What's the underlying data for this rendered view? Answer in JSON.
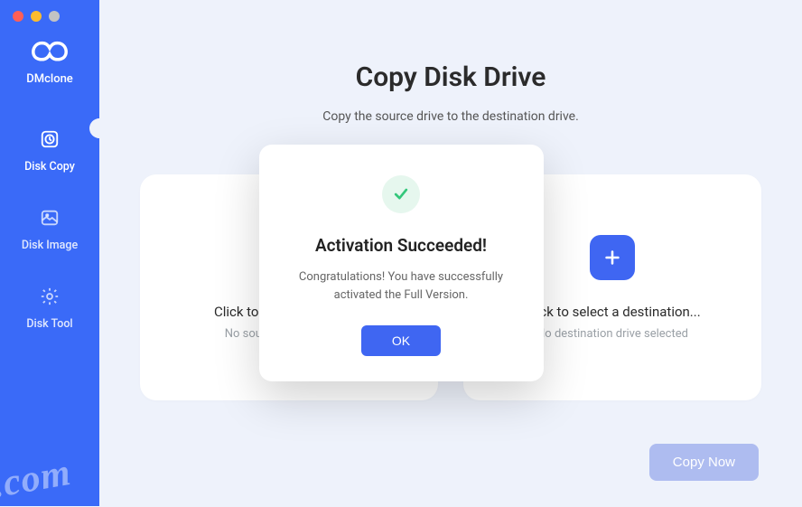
{
  "brand": {
    "name": "DMclone"
  },
  "sidebar": {
    "items": [
      {
        "label": "Disk Copy",
        "icon": "disk-copy-icon",
        "active": true
      },
      {
        "label": "Disk Image",
        "icon": "disk-image-icon",
        "active": false
      },
      {
        "label": "Disk Tool",
        "icon": "gear-icon",
        "active": false
      }
    ]
  },
  "main": {
    "title": "Copy Disk Drive",
    "subtitle": "Copy the source drive to the destination drive.",
    "source_card": {
      "title": "Click to select a source...",
      "subtitle": "No source drive selected"
    },
    "dest_card": {
      "title": "Click to select a destination...",
      "subtitle": "No destination drive selected"
    },
    "copy_button": "Copy Now"
  },
  "modal": {
    "title": "Activation Succeeded!",
    "message": "Congratulations! You have successfully\nactivated the Full Version.",
    "ok": "OK"
  },
  "watermark": ".com",
  "colors": {
    "sidebar": "#3a6af8",
    "accent": "#3f66f2",
    "success_bg": "#e6f7ee",
    "success": "#34c77b"
  }
}
